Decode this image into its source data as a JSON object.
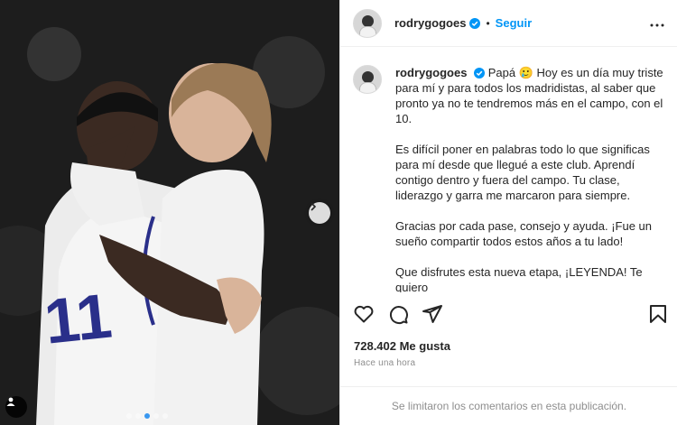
{
  "post": {
    "username": "rodrygogoes",
    "separator": "•",
    "follow_label": "Seguir",
    "caption": {
      "p1": "Papá 🥲 Hoy es un día muy triste para mí y para todos los madridistas, al saber que pronto ya no te tendremos más en el campo, con el 10.",
      "p2": "Es difícil poner en palabras todo lo que significas para mí desde que llegué a este club. Aprendí contigo dentro y fuera del campo. Tu clase, liderazgo y garra me marcaron para siempre.",
      "p3": "Gracias por cada pase, consejo y ayuda. ¡Fue un sueño compartir todos estos años a tu lado!",
      "p4": "Que disfrutes esta nueva etapa, ¡LEYENDA! Te quiero",
      "p4_emojis": "🤍 🔟 🎩"
    },
    "likes": "728.402 Me gusta",
    "time_ago": "Hace una hora",
    "comments_disabled": "Se limitaron los comentarios en esta publicación."
  },
  "carousel": {
    "total_slides": 5,
    "active_slide": 2
  },
  "colors": {
    "accent": "#0095f6",
    "verified": "#0095f6",
    "muted": "#8e8e8e",
    "border": "#efefef"
  },
  "icons": [
    "verified-badge-icon",
    "more-options-icon",
    "like-heart-icon",
    "comment-icon",
    "share-icon",
    "save-bookmark-icon",
    "next-arrow-icon",
    "user-tag-icon"
  ]
}
